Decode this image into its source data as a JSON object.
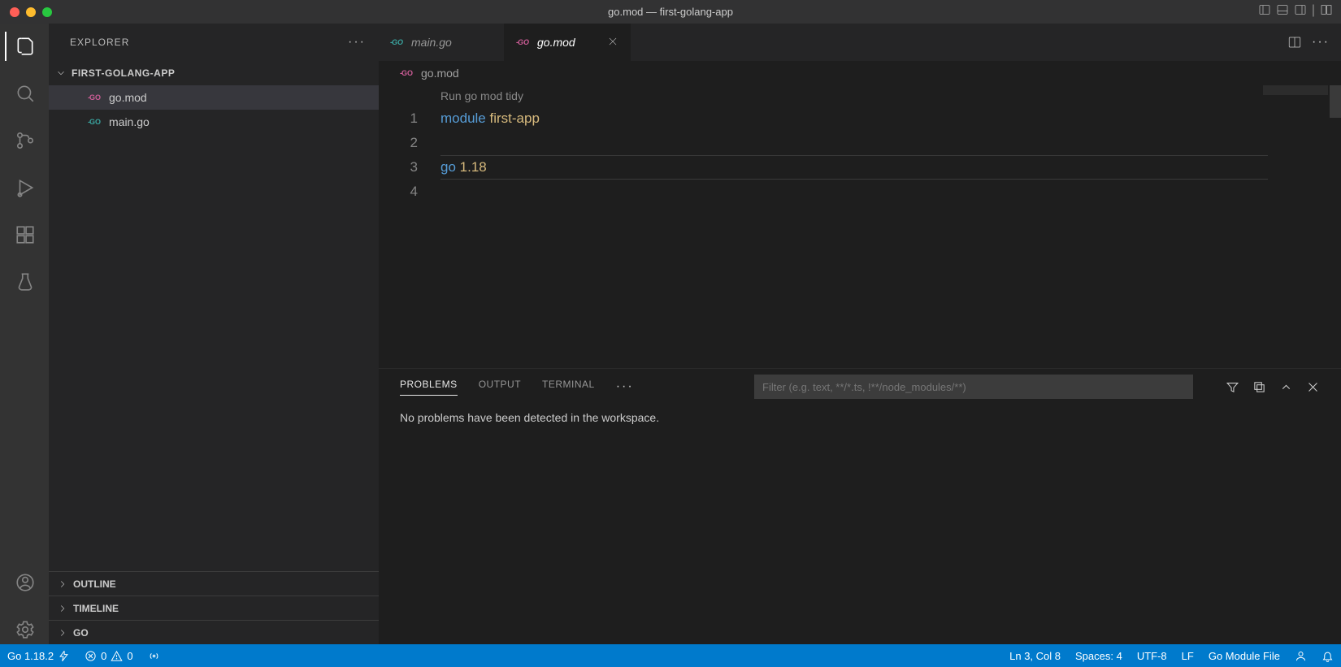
{
  "title": "go.mod — first-golang-app",
  "sidebar": {
    "header": "EXPLORER",
    "folder": "FIRST-GOLANG-APP",
    "files": [
      {
        "name": "go.mod",
        "iconKind": "pink",
        "active": true
      },
      {
        "name": "main.go",
        "iconKind": "teal",
        "active": false
      }
    ],
    "sections": [
      "OUTLINE",
      "TIMELINE",
      "GO"
    ]
  },
  "tabs": [
    {
      "label": "main.go",
      "iconKind": "teal",
      "active": false
    },
    {
      "label": "go.mod",
      "iconKind": "pink",
      "active": true
    }
  ],
  "breadcrumb": {
    "file": "go.mod",
    "iconKind": "pink"
  },
  "editor": {
    "codelens": "Run go mod tidy",
    "lines": [
      {
        "n": 1,
        "tokens": [
          {
            "t": "module",
            "c": "kw"
          },
          {
            "t": " ",
            "c": ""
          },
          {
            "t": "first-app",
            "c": "id"
          }
        ]
      },
      {
        "n": 2,
        "tokens": []
      },
      {
        "n": 3,
        "tokens": [
          {
            "t": "go",
            "c": "kw"
          },
          {
            "t": " ",
            "c": ""
          },
          {
            "t": "1.18",
            "c": "id"
          }
        ]
      },
      {
        "n": 4,
        "tokens": []
      }
    ],
    "currentLine": 3
  },
  "panel": {
    "tabs": [
      "PROBLEMS",
      "OUTPUT",
      "TERMINAL"
    ],
    "activeTab": "PROBLEMS",
    "filterPlaceholder": "Filter (e.g. text, **/*.ts, !**/node_modules/**)",
    "message": "No problems have been detected in the workspace."
  },
  "status": {
    "goVersion": "Go 1.18.2",
    "errors": "0",
    "warnings": "0",
    "cursor": "Ln 3, Col 8",
    "spaces": "Spaces: 4",
    "encoding": "UTF-8",
    "eol": "LF",
    "language": "Go Module File"
  }
}
